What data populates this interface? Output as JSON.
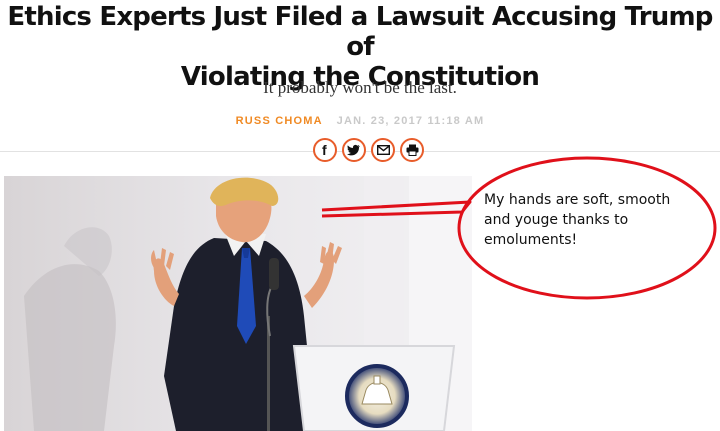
{
  "article": {
    "headline_line1": "Ethics Experts Just Filed a Lawsuit Accusing Trump of",
    "headline_line2": "Violating the Constitution",
    "dek": "It probably won't be the last.",
    "author": "RUSS CHOMA",
    "date": "JAN. 23, 2017 11:18 AM"
  },
  "share": {
    "icons": [
      "facebook-icon",
      "twitter-icon",
      "email-icon",
      "print-icon"
    ],
    "accent_color": "#e85c2a"
  },
  "annotation": {
    "callout_text": "My hands are soft, smooth and youge thanks to emoluments!",
    "color": "#e0101a"
  },
  "colors": {
    "author": "#f08a24",
    "date": "#c9c9c9"
  }
}
